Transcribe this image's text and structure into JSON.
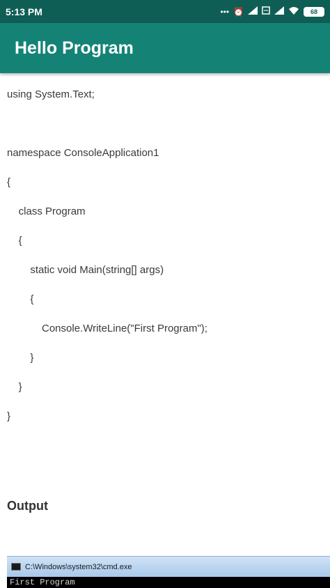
{
  "status_bar": {
    "time": "5:13 PM",
    "icons": [
      "more-dots-icon",
      "alarm-icon",
      "signal-icon",
      "sim-icon",
      "signal-icon",
      "wifi-icon"
    ],
    "battery": "68"
  },
  "app_bar": {
    "title": "Hello Program"
  },
  "code_lines": [
    "using System.Text;",
    "",
    "namespace ConsoleApplication1",
    "{",
    "    class Program",
    "    {",
    "        static void Main(string[] args)",
    "        {",
    "            Console.WriteLine(\"First Program\");",
    "        }",
    "    }",
    "}"
  ],
  "output": {
    "label": "Output",
    "console_title": "C:\\Windows\\system32\\cmd.exe",
    "console_text": "First Program"
  },
  "colors": {
    "status_bar": "#0f5e55",
    "app_bar": "#148376"
  }
}
